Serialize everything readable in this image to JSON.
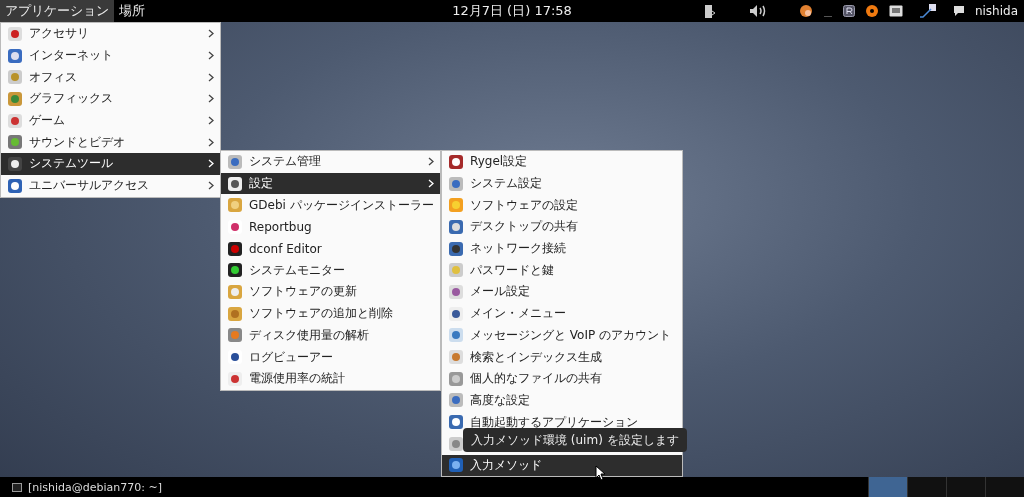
{
  "top_panel": {
    "menus": [
      {
        "label": "アプリケーション",
        "selected": true
      },
      {
        "label": "場所",
        "selected": false
      }
    ],
    "clock": "12月7日 (日) 17:58",
    "user": "nishida"
  },
  "applications_menu": {
    "items": [
      {
        "label": "アクセサリ",
        "selected": false,
        "has_submenu": true
      },
      {
        "label": "インターネット",
        "selected": false,
        "has_submenu": true
      },
      {
        "label": "オフィス",
        "selected": false,
        "has_submenu": true
      },
      {
        "label": "グラフィックス",
        "selected": false,
        "has_submenu": true
      },
      {
        "label": "ゲーム",
        "selected": false,
        "has_submenu": true
      },
      {
        "label": "サウンドとビデオ",
        "selected": false,
        "has_submenu": true
      },
      {
        "label": "システムツール",
        "selected": true,
        "has_submenu": true
      },
      {
        "label": "ユニバーサルアクセス",
        "selected": false,
        "has_submenu": true
      }
    ]
  },
  "system_tools_menu": {
    "items": [
      {
        "label": "システム管理",
        "selected": false,
        "has_submenu": true
      },
      {
        "label": "設定",
        "selected": true,
        "has_submenu": true
      },
      {
        "label": "GDebi パッケージインストーラー",
        "selected": false,
        "has_submenu": false
      },
      {
        "label": "Reportbug",
        "selected": false,
        "has_submenu": false
      },
      {
        "label": "dconf Editor",
        "selected": false,
        "has_submenu": false
      },
      {
        "label": "システムモニター",
        "selected": false,
        "has_submenu": false
      },
      {
        "label": "ソフトウェアの更新",
        "selected": false,
        "has_submenu": false
      },
      {
        "label": "ソフトウェアの追加と削除",
        "selected": false,
        "has_submenu": false
      },
      {
        "label": "ディスク使用量の解析",
        "selected": false,
        "has_submenu": false
      },
      {
        "label": "ログビューアー",
        "selected": false,
        "has_submenu": false
      },
      {
        "label": "電源使用率の統計",
        "selected": false,
        "has_submenu": false
      }
    ]
  },
  "settings_menu": {
    "items": [
      {
        "label": "Rygel設定",
        "selected": false
      },
      {
        "label": "システム設定",
        "selected": false
      },
      {
        "label": "ソフトウェアの設定",
        "selected": false
      },
      {
        "label": "デスクトップの共有",
        "selected": false
      },
      {
        "label": "ネットワーク接続",
        "selected": false
      },
      {
        "label": "パスワードと鍵",
        "selected": false
      },
      {
        "label": "メール設定",
        "selected": false
      },
      {
        "label": "メイン・メニュー",
        "selected": false
      },
      {
        "label": "メッセージングと VoIP のアカウント",
        "selected": false
      },
      {
        "label": "検索とインデックス生成",
        "selected": false
      },
      {
        "label": "個人的なファイルの共有",
        "selected": false
      },
      {
        "label": "高度な設定",
        "selected": false
      },
      {
        "label": "自動起動するアプリケーション",
        "selected": false
      },
      {
        "selected": false
      },
      {
        "label": "入力メソッド",
        "selected": true
      }
    ]
  },
  "tooltip": "入力メソッド環境 (uim) を設定します",
  "bottom_panel": {
    "tasks": [
      {
        "label": "[nishida@debian770: ~]"
      }
    ],
    "workspaces": [
      {
        "selected": true
      },
      {
        "selected": false
      },
      {
        "selected": false
      },
      {
        "selected": false
      }
    ]
  }
}
